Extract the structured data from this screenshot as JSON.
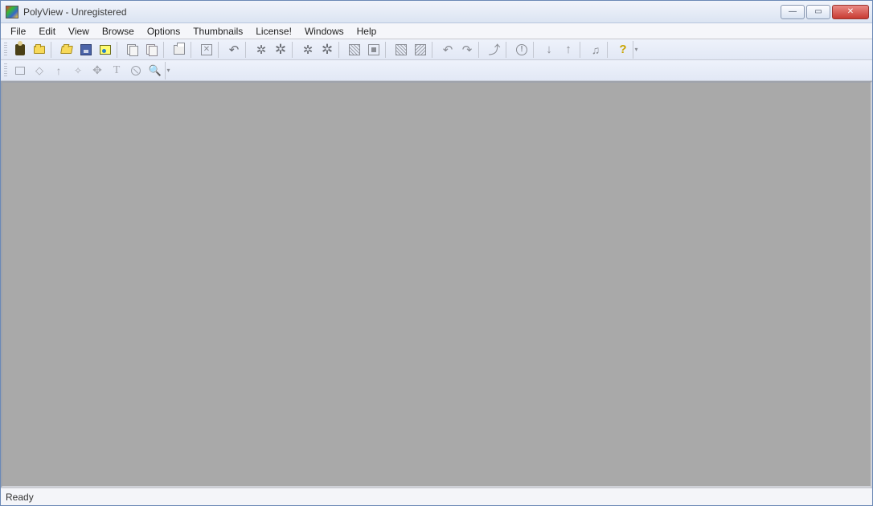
{
  "window": {
    "title": "PolyView - Unregistered"
  },
  "menu": {
    "items": [
      "File",
      "Edit",
      "View",
      "Browse",
      "Options",
      "Thumbnails",
      "License!",
      "Windows",
      "Help"
    ]
  },
  "toolbar1": {
    "items": [
      {
        "name": "browse-button",
        "icon": "person"
      },
      {
        "name": "new-folder-button",
        "icon": "folder"
      },
      {
        "sep": true
      },
      {
        "name": "open-button",
        "icon": "open"
      },
      {
        "name": "save-button",
        "icon": "disk"
      },
      {
        "name": "image-button",
        "icon": "image"
      },
      {
        "sep": true
      },
      {
        "name": "copy-button",
        "icon": "copy"
      },
      {
        "name": "paste-button",
        "icon": "paste"
      },
      {
        "sep": true
      },
      {
        "name": "print-button",
        "icon": "print"
      },
      {
        "sep": true
      },
      {
        "name": "fullscreen-button",
        "icon": "boxx"
      },
      {
        "sep": true
      },
      {
        "name": "undo-button",
        "icon": "undo"
      },
      {
        "sep": true
      },
      {
        "name": "brightness-down-button",
        "icon": "gear"
      },
      {
        "name": "brightness-up-button",
        "icon": "gear"
      },
      {
        "sep": true
      },
      {
        "name": "contrast-down-button",
        "icon": "gear"
      },
      {
        "name": "contrast-up-button",
        "icon": "gear"
      },
      {
        "sep": true
      },
      {
        "name": "effect-a-button",
        "icon": "hatch"
      },
      {
        "name": "effect-b-button",
        "icon": "square"
      },
      {
        "sep": true
      },
      {
        "name": "effect-c-button",
        "icon": "hatch"
      },
      {
        "name": "effect-d-button",
        "icon": "hatch"
      },
      {
        "sep": true
      },
      {
        "name": "redo-left-button",
        "icon": "redo-l"
      },
      {
        "name": "redo-right-button",
        "icon": "redo-r"
      },
      {
        "sep": true
      },
      {
        "name": "rotate-button",
        "icon": "rotate"
      },
      {
        "sep": true
      },
      {
        "name": "info-button",
        "icon": "bang"
      },
      {
        "sep": true
      },
      {
        "name": "down-button",
        "icon": "arrow-down"
      },
      {
        "name": "up-button",
        "icon": "arrow-up"
      },
      {
        "sep": true
      },
      {
        "name": "slideshow-button",
        "icon": "note"
      },
      {
        "sep": true
      },
      {
        "name": "help-button",
        "icon": "help"
      }
    ]
  },
  "toolbar2": {
    "items": [
      {
        "name": "select-rect-button",
        "icon": "rect"
      },
      {
        "name": "select-lasso-button",
        "icon": "lasso"
      },
      {
        "name": "arrow-tool-button",
        "icon": "arrowup"
      },
      {
        "name": "star-tool-button",
        "icon": "star"
      },
      {
        "name": "move-tool-button",
        "icon": "move"
      },
      {
        "name": "text-tool-button",
        "icon": "text"
      },
      {
        "name": "noentry-tool-button",
        "icon": "noentry"
      },
      {
        "name": "zoom-tool-button",
        "icon": "zoom"
      }
    ]
  },
  "status": {
    "text": "Ready"
  }
}
